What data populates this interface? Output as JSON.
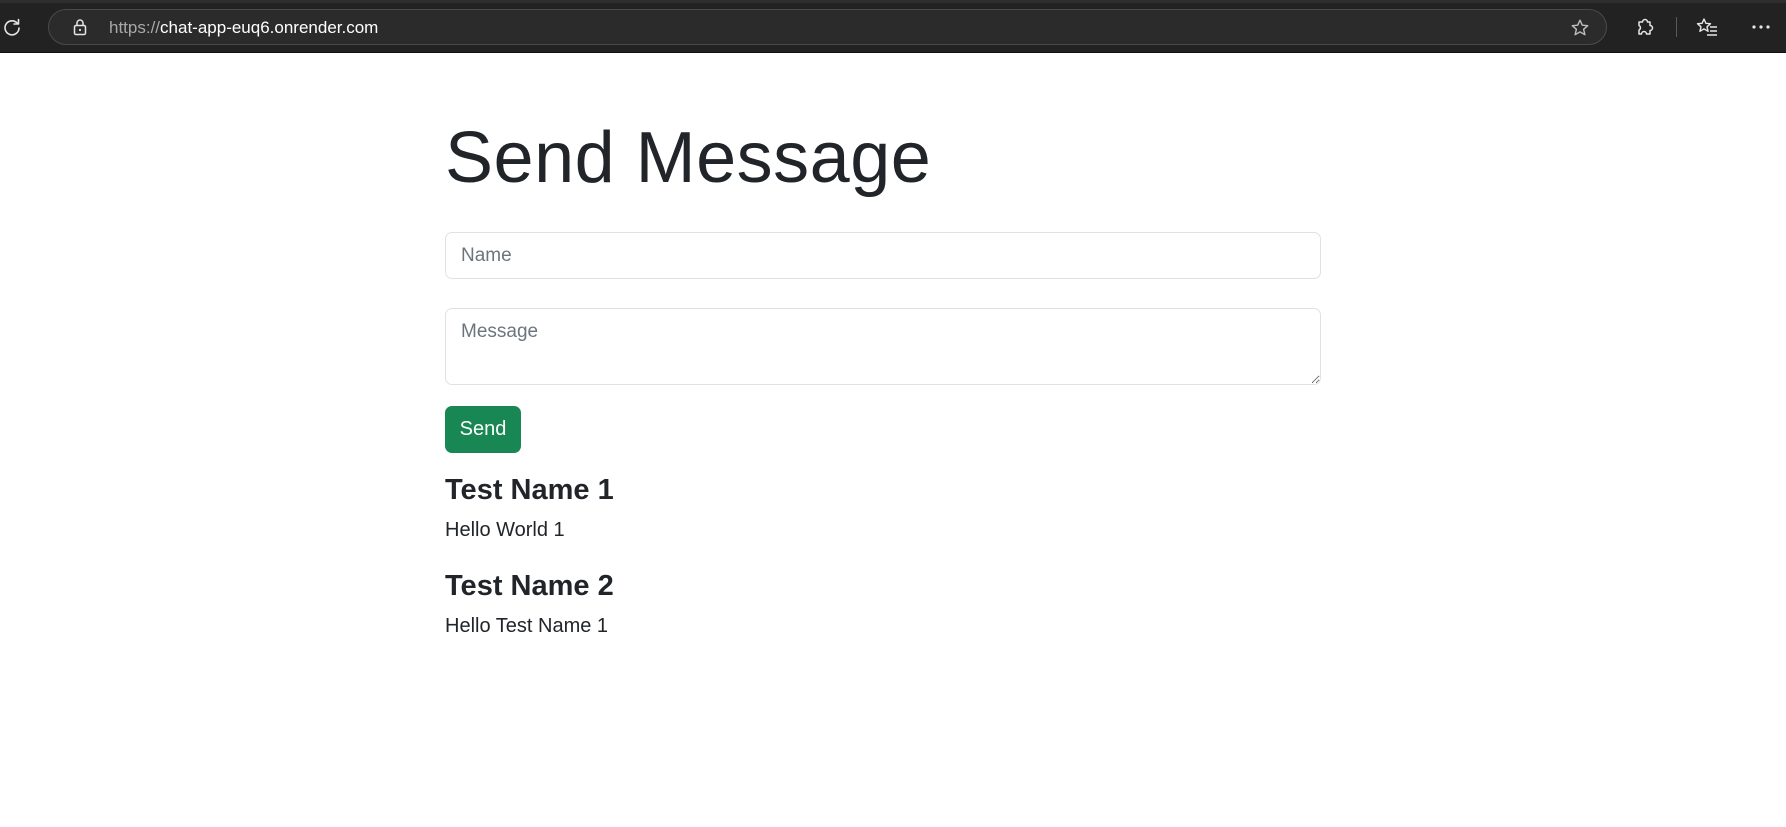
{
  "browser": {
    "url_scheme": "https://",
    "url_host": "chat-app-euq6.onrender.com",
    "icons": {
      "reload": "reload-icon",
      "lock": "lock-icon",
      "favorite": "star-icon",
      "extensions": "puzzle-icon",
      "favorites_list": "favorites-list-icon",
      "menu": "more-menu-icon"
    }
  },
  "page": {
    "title": "Send Message",
    "name_placeholder": "Name",
    "message_placeholder": "Message",
    "send_label": "Send",
    "accent_color": "#198754"
  },
  "messages": [
    {
      "author": "Test Name 1",
      "text": "Hello World 1"
    },
    {
      "author": "Test Name 2",
      "text": "Hello Test Name 1"
    }
  ]
}
